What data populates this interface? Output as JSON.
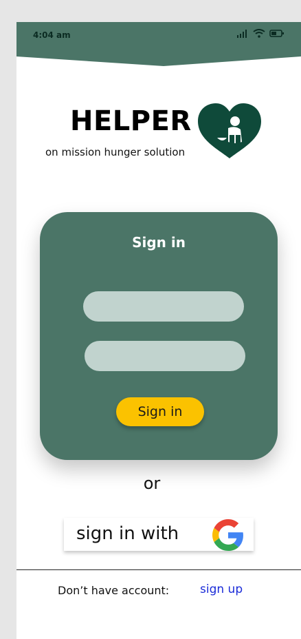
{
  "status_bar": {
    "time": "4:04 am",
    "icons": [
      "signal-icon",
      "wifi-icon",
      "battery-icon"
    ]
  },
  "brand": {
    "title": "HELPER",
    "subtitle": "on mission hunger solution",
    "logo_icon": "heart-helper-logo-icon"
  },
  "signin_card": {
    "title": "Sign in",
    "username_placeholder": "",
    "password_placeholder": "",
    "button_label": "Sign in"
  },
  "divider_text": "or",
  "google_signin": {
    "label": "sign in with",
    "icon": "google-icon"
  },
  "footer": {
    "prompt": "Don’t have account:",
    "link_label": "sign up"
  },
  "colors": {
    "primary": "#4b7567",
    "dark_green": "#0f4a3a",
    "field": "#c1d3ce",
    "button": "#fbc200",
    "link": "#1a2bd8"
  }
}
